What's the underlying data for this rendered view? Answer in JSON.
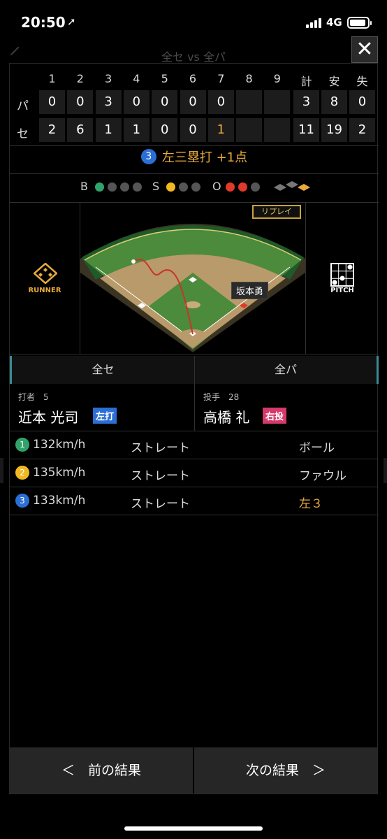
{
  "status": {
    "time": "20:50",
    "network": "4G"
  },
  "page": {
    "title": "全セ vs 全パ"
  },
  "scoreboard": {
    "innings": [
      "1",
      "2",
      "3",
      "4",
      "5",
      "6",
      "7",
      "8",
      "9"
    ],
    "totals_headers": [
      "計",
      "安",
      "失"
    ],
    "rows": [
      {
        "team": "パ",
        "scores": [
          "0",
          "0",
          "3",
          "0",
          "0",
          "0",
          "0",
          "",
          ""
        ],
        "totals": [
          "3",
          "8",
          "0"
        ]
      },
      {
        "team": "セ",
        "scores": [
          "2",
          "6",
          "1",
          "1",
          "0",
          "0",
          "1",
          "",
          ""
        ],
        "totals": [
          "11",
          "19",
          "2"
        ]
      }
    ]
  },
  "play": {
    "number": "3",
    "text": "左三塁打 +1点"
  },
  "count": {
    "b_label": "B",
    "s_label": "S",
    "o_label": "O",
    "balls": 1,
    "strikes": 1,
    "outs": 2
  },
  "field": {
    "runner_label": "RUNNER",
    "pitch_label": "PITCH",
    "replay_label": "リプレイ",
    "batter_tag": "坂本勇"
  },
  "teams": {
    "left": "全セ",
    "right": "全パ"
  },
  "batter": {
    "role": "打者　5",
    "name": "近本 光司",
    "badge": "左打"
  },
  "pitcher": {
    "role": "投手　28",
    "name": "高橋 礼",
    "badge": "右投"
  },
  "pitches": [
    {
      "num": "1",
      "color": "#31a36a",
      "speed": "132km/h",
      "type": "ストレート",
      "result": "ボール",
      "hl": false
    },
    {
      "num": "2",
      "color": "#f2b822",
      "speed": "135km/h",
      "type": "ストレート",
      "result": "ファウル",
      "hl": false
    },
    {
      "num": "3",
      "color": "#2b6fd6",
      "speed": "133km/h",
      "type": "ストレート",
      "result": "左３",
      "hl": true
    }
  ],
  "nav": {
    "prev": "＜　前の結果",
    "next": "次の結果　＞"
  },
  "colors": {
    "accent": "#e8a93c",
    "ball": "#31a36a",
    "strike": "#f2b822",
    "out": "#e03a2a"
  }
}
